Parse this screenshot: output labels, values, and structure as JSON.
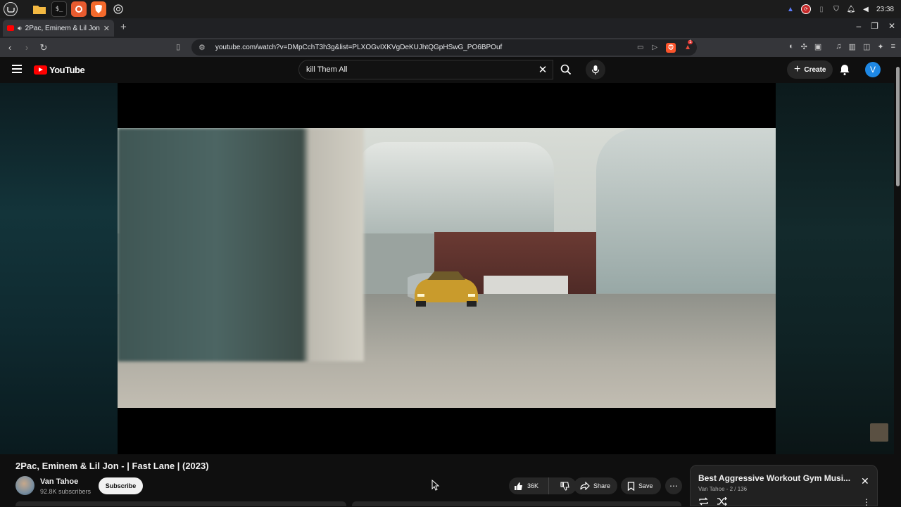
{
  "os": {
    "clock": "23:38",
    "apps": [
      "mint-menu",
      "files",
      "terminal",
      "firefox",
      "brave",
      "web-app"
    ]
  },
  "browser": {
    "tab_title": "2Pac, Eminem & Lil Jon - | F",
    "url": "youtube.com/watch?v=DMpCchT3h3g&list=PLXOGvIXKVgDeKUJhtQGpHSwG_PO6BPOuf",
    "brave_badge": "1"
  },
  "youtube": {
    "logo_text": "YouTube",
    "search_value": "kill Them All",
    "create_label": "Create",
    "avatar_initial": "V"
  },
  "video": {
    "title": "2Pac, Eminem & Lil Jon - | Fast Lane | (2023)",
    "channel_name": "Van Tahoe",
    "subscribers": "92.8K subscribers",
    "subscribe_label": "Subscribe",
    "likes": "36K",
    "share_label": "Share",
    "save_label": "Save"
  },
  "playlist": {
    "title": "Best Aggressive Workout Gym Musi...",
    "meta": "Van Tahoe - 2 / 136"
  },
  "colors": {
    "youtube_red": "#ff0000",
    "background": "#0f0f0f",
    "avatar_blue": "#1e88e5"
  }
}
